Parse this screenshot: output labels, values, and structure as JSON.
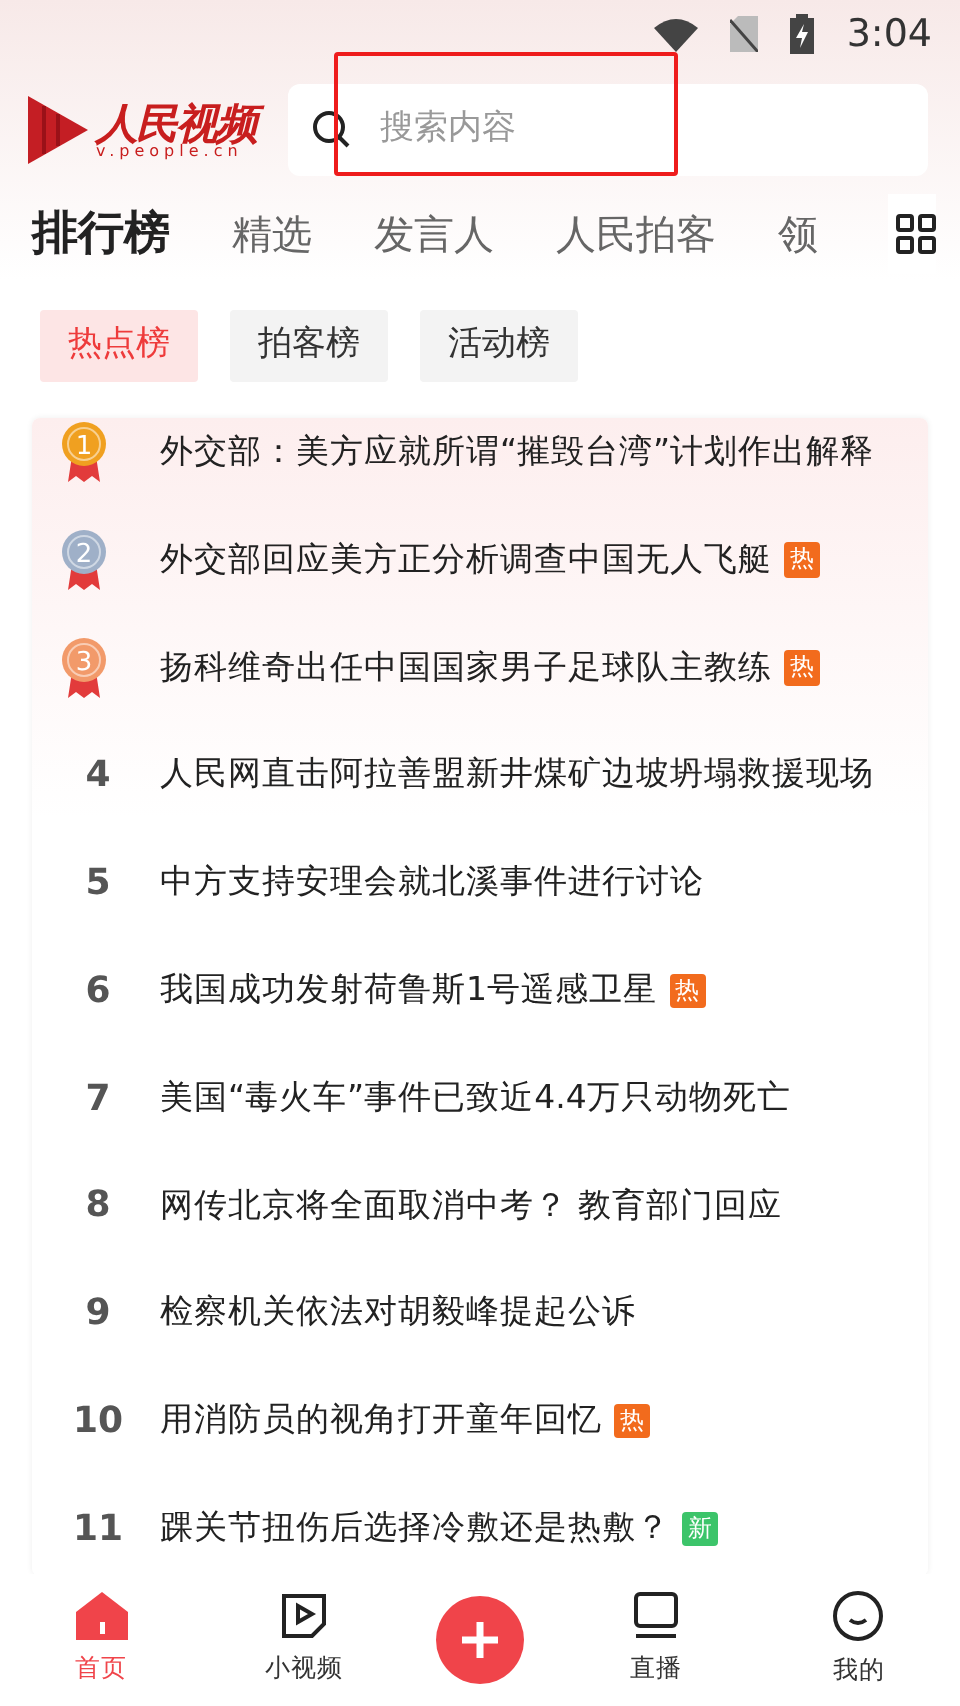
{
  "status_bar": {
    "time": "3:04"
  },
  "header": {
    "logo": {
      "title": "人民视频",
      "subtitle": "v.people.cn"
    },
    "search": {
      "placeholder": "搜索内容",
      "highlighted": true
    }
  },
  "tabs": [
    {
      "label": "排行榜",
      "selected": true
    },
    {
      "label": "精选",
      "selected": false
    },
    {
      "label": "发言人",
      "selected": false
    },
    {
      "label": "人民拍客",
      "selected": false
    },
    {
      "label": "领",
      "selected": false
    }
  ],
  "chips": [
    {
      "label": "热点榜",
      "selected": true
    },
    {
      "label": "拍客榜",
      "selected": false
    },
    {
      "label": "活动榜",
      "selected": false
    }
  ],
  "ranking": [
    {
      "rank": "1",
      "kind": "medal",
      "color": "#f0a020",
      "title": "外交部：美方应就所谓“摧毁台湾”计划作出解释"
    },
    {
      "rank": "2",
      "kind": "medal",
      "color": "#9fb0c8",
      "title": "外交部回应美方正分析调查中国无人飞艇",
      "tag": {
        "label": "热",
        "color": "#f26b1d"
      }
    },
    {
      "rank": "3",
      "kind": "medal",
      "color": "#f29a6a",
      "title": "扬科维奇出任中国国家男子足球队主教练",
      "tag": {
        "label": "热",
        "color": "#f26b1d"
      }
    },
    {
      "rank": "4",
      "kind": "number",
      "title": "人民网直击阿拉善盟新井煤矿边坡坍塌救援现场"
    },
    {
      "rank": "5",
      "kind": "number",
      "title": "中方支持安理会就北溪事件进行讨论"
    },
    {
      "rank": "6",
      "kind": "number",
      "title": "我国成功发射荷鲁斯1号遥感卫星",
      "tag": {
        "label": "热",
        "color": "#f26b1d"
      }
    },
    {
      "rank": "7",
      "kind": "number",
      "title": "美国“毒火车”事件已致近4.4万只动物死亡"
    },
    {
      "rank": "8",
      "kind": "number",
      "title": "网传北京将全面取消中考？ 教育部门回应"
    },
    {
      "rank": "9",
      "kind": "number",
      "title": "检察机关依法对胡毅峰提起公诉"
    },
    {
      "rank": "10",
      "kind": "number",
      "title": "用消防员的视角打开童年回忆",
      "tag": {
        "label": "热",
        "color": "#f26b1d"
      }
    },
    {
      "rank": "11",
      "kind": "number",
      "title": "踝关节扭伤后选择冷敷还是热敷？",
      "tag": {
        "label": "新",
        "color": "#3cc46a"
      }
    }
  ],
  "bottom_nav": [
    {
      "label": "首页",
      "selected": true
    },
    {
      "label": "小视频",
      "selected": false
    },
    {
      "selected": false
    },
    {
      "label": "直播",
      "selected": false
    },
    {
      "label": "我的",
      "selected": false
    }
  ]
}
